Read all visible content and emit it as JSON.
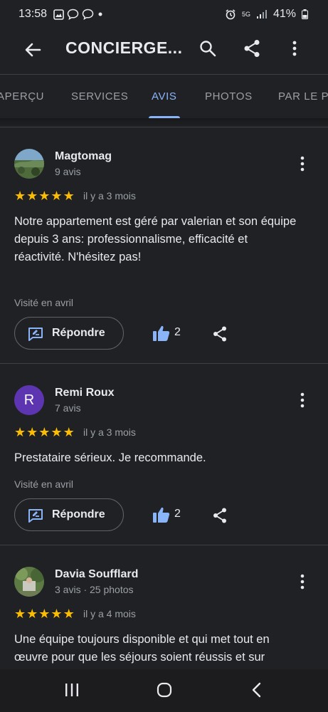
{
  "status": {
    "time": "13:58",
    "battery": "41%",
    "network": "5G"
  },
  "appbar": {
    "title": "CONCIERGE..."
  },
  "tabs": [
    {
      "label": "APERÇU"
    },
    {
      "label": "SERVICES"
    },
    {
      "label": "AVIS"
    },
    {
      "label": "PHOTOS"
    },
    {
      "label": "PAR LE PR"
    }
  ],
  "active_tab": "AVIS",
  "reviews": [
    {
      "name": "Magtomag",
      "meta": "9 avis",
      "rating": 5,
      "date": "il y a 3 mois",
      "text": "Notre appartement est géré par valerian et son équipe depuis 3 ans: professionnalisme, efficacité et réactivité. N'hésitez pas!",
      "visited": "Visité en avril",
      "reply_label": "Répondre",
      "likes": "2"
    },
    {
      "name": "Remi Roux",
      "avatar_letter": "R",
      "meta": "7 avis",
      "rating": 5,
      "date": "il y a 3 mois",
      "text": "Prestataire sérieux. Je recommande.",
      "visited": "Visité en avril",
      "reply_label": "Répondre",
      "likes": "2"
    },
    {
      "name": "Davia Soufflard",
      "meta": "3 avis · 25 photos",
      "rating": 5,
      "date": "il y a 4 mois",
      "text": "Une équipe toujours disponible et qui met tout en œuvre pour que les séjours soient réussis et sur"
    }
  ],
  "colors": {
    "accent": "#8ab4f8",
    "star": "#fbbc04",
    "background": "#202124",
    "avatar_r": "#5e35b1"
  }
}
